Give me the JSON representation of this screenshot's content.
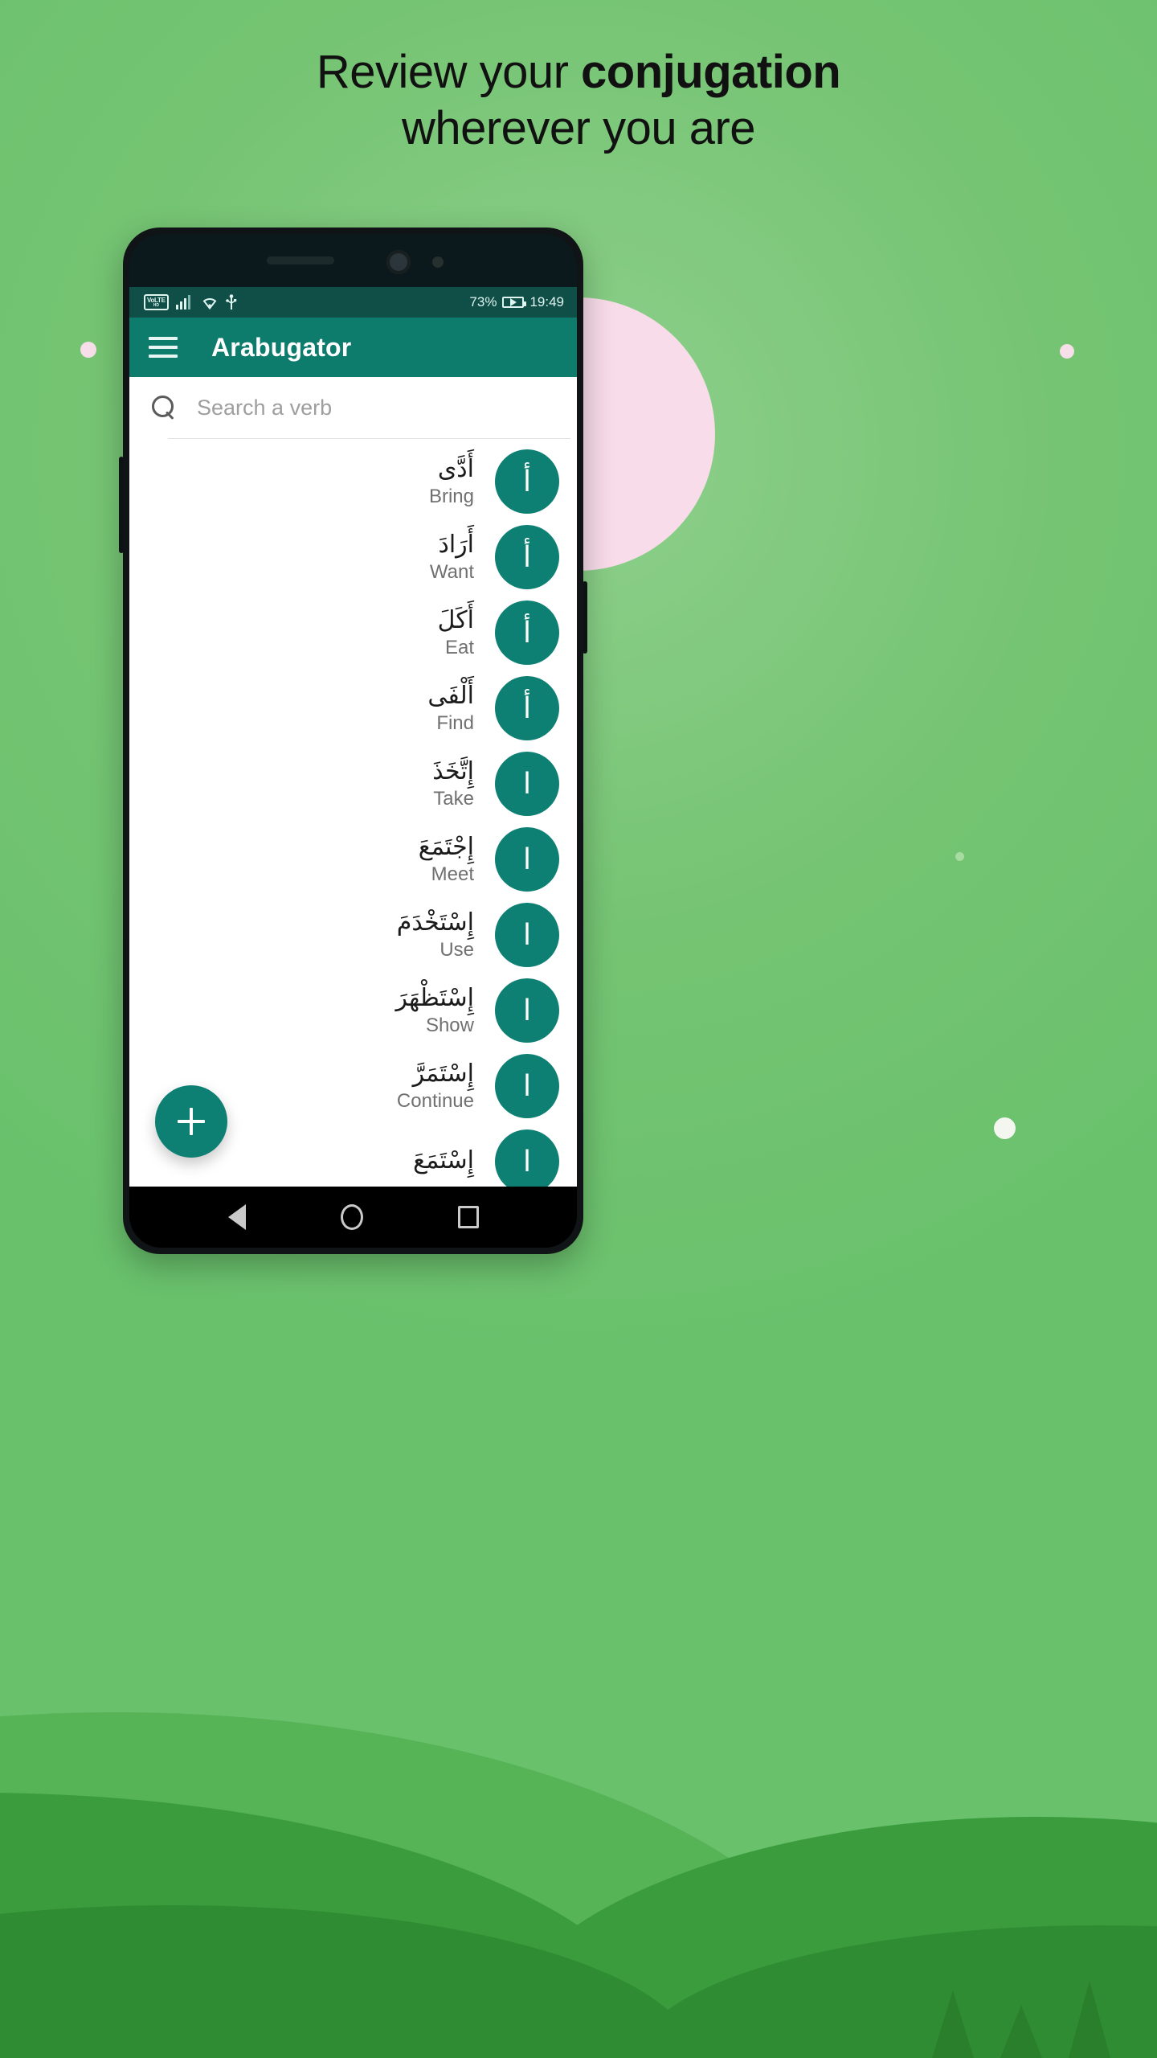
{
  "promo": {
    "headline_line1_plain": "Review your ",
    "headline_line1_bold": "conjugation",
    "headline_line2": "wherever you are"
  },
  "colors": {
    "background_green": "#69c16c",
    "hill_dark_green": "#3a9c3c",
    "accent_teal": "#0d8073",
    "appbar_teal": "#0e7c6d",
    "statusbar_teal": "#0f4f48",
    "pink_circle": "#f8dce9"
  },
  "statusbar": {
    "volte_label": "VoLTE",
    "volte_sub": "HD",
    "signal_icon": "signal-bars-icon",
    "wifi_icon": "wifi-icon",
    "usb_icon": "usb-icon",
    "battery_percent": "73%",
    "battery_icon": "battery-charging-icon",
    "time": "19:49"
  },
  "appbar": {
    "menu_icon": "hamburger-menu-icon",
    "title": "Arabugator"
  },
  "search": {
    "icon": "search-icon",
    "placeholder": "Search a verb",
    "value": ""
  },
  "fab": {
    "icon": "plus-icon",
    "label": "+"
  },
  "navbar": {
    "back": "back-triangle-icon",
    "home": "home-circle-icon",
    "recents": "recents-square-icon"
  },
  "verbs": [
    {
      "arabic": "أَدَّى",
      "english": "Bring",
      "avatar": "أ"
    },
    {
      "arabic": "أَرَادَ",
      "english": "Want",
      "avatar": "أ"
    },
    {
      "arabic": "أَكَلَ",
      "english": "Eat",
      "avatar": "أ"
    },
    {
      "arabic": "أَلْفَى",
      "english": "Find",
      "avatar": "أ"
    },
    {
      "arabic": "إِتَّخَذَ",
      "english": "Take",
      "avatar": "ا"
    },
    {
      "arabic": "إِجْتَمَعَ",
      "english": "Meet",
      "avatar": "ا"
    },
    {
      "arabic": "إِسْتَخْدَمَ",
      "english": "Use",
      "avatar": "ا"
    },
    {
      "arabic": "إِسْتَظْهَرَ",
      "english": "Show",
      "avatar": "ا"
    },
    {
      "arabic": "إِسْتَمَرَّ",
      "english": "Continue",
      "avatar": "ا"
    },
    {
      "arabic": "إِسْتَمَعَ",
      "english": "",
      "avatar": "ا"
    }
  ]
}
